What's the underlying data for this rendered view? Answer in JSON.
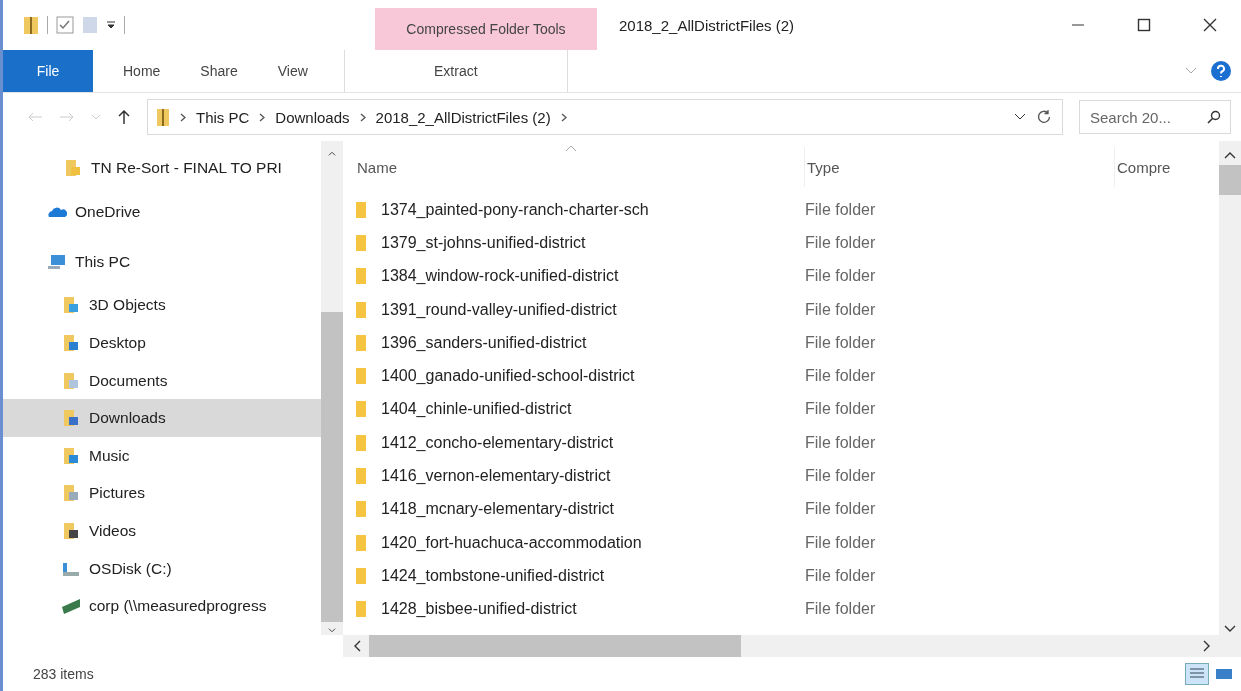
{
  "window": {
    "title": "2018_2_AllDistrictFiles (2)",
    "context_group": "Compressed Folder Tools"
  },
  "ribbon_tabs": [
    {
      "label": "File",
      "kind": "file",
      "selected": false
    },
    {
      "label": "Home",
      "kind": "normal",
      "selected": false
    },
    {
      "label": "Share",
      "kind": "normal",
      "selected": false
    },
    {
      "label": "View",
      "kind": "normal",
      "selected": false
    },
    {
      "label": "Extract",
      "kind": "contextual",
      "selected": false
    }
  ],
  "address_bar": {
    "crumbs": [
      "This PC",
      "Downloads",
      "2018_2_AllDistrictFiles (2)"
    ]
  },
  "search": {
    "placeholder": "Search 20..."
  },
  "sidebar": {
    "items": [
      {
        "label": "TN Re-Sort - FINAL TO PRI",
        "kind": "folder",
        "selected": false
      },
      {
        "label": "OneDrive",
        "kind": "cloud",
        "selected": false
      },
      {
        "label": "This PC",
        "kind": "pc",
        "selected": false,
        "children": [
          {
            "label": "3D Objects",
            "kind": "objects",
            "selected": false
          },
          {
            "label": "Desktop",
            "kind": "desktop",
            "selected": false
          },
          {
            "label": "Documents",
            "kind": "documents",
            "selected": false
          },
          {
            "label": "Downloads",
            "kind": "downloads",
            "selected": true
          },
          {
            "label": "Music",
            "kind": "music",
            "selected": false
          },
          {
            "label": "Pictures",
            "kind": "pictures",
            "selected": false
          },
          {
            "label": "Videos",
            "kind": "videos",
            "selected": false
          },
          {
            "label": "OSDisk (C:)",
            "kind": "disk",
            "selected": false
          },
          {
            "label": "corp (\\\\measuredprogress",
            "kind": "network",
            "selected": false
          }
        ]
      }
    ]
  },
  "table": {
    "columns": [
      "Name",
      "Type",
      "Compre"
    ],
    "rows": [
      [
        "1374_painted-pony-ranch-charter-sch",
        "File folder"
      ],
      [
        "1379_st-johns-unified-district",
        "File folder"
      ],
      [
        "1384_window-rock-unified-district",
        "File folder"
      ],
      [
        "1391_round-valley-unified-district",
        "File folder"
      ],
      [
        "1396_sanders-unified-district",
        "File folder"
      ],
      [
        "1400_ganado-unified-school-district",
        "File folder"
      ],
      [
        "1404_chinle-unified-district",
        "File folder"
      ],
      [
        "1412_concho-elementary-district",
        "File folder"
      ],
      [
        "1416_vernon-elementary-district",
        "File folder"
      ],
      [
        "1418_mcnary-elementary-district",
        "File folder"
      ],
      [
        "1420_fort-huachuca-accommodation",
        "File folder"
      ],
      [
        "1424_tombstone-unified-district",
        "File folder"
      ],
      [
        "1428_bisbee-unified-district",
        "File folder"
      ]
    ]
  },
  "status_bar": {
    "count": "283 items"
  }
}
